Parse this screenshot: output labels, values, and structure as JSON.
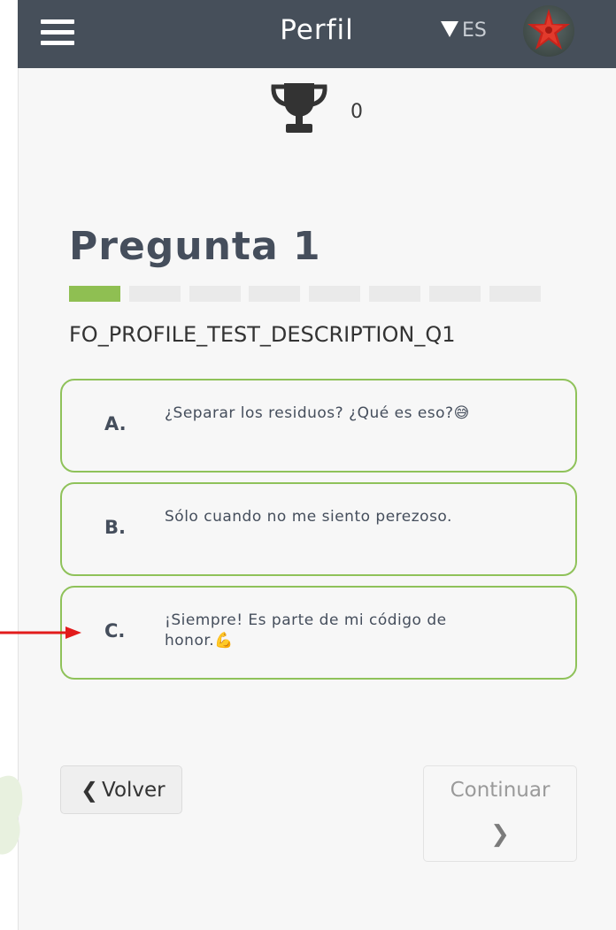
{
  "header": {
    "title": "Perfil",
    "language": "ES",
    "menu_icon": "hamburger-icon",
    "avatar_icon": "starfish-avatar"
  },
  "score": {
    "icon": "trophy-icon",
    "value": "0"
  },
  "question": {
    "title": "Pregunta 1",
    "description": "FO_PROFILE_TEST_DESCRIPTION_Q1",
    "progress": {
      "current": 1,
      "total": 8
    },
    "options": [
      {
        "letter": "A.",
        "text": "¿Separar los residuos? ¿Qué es eso?😅"
      },
      {
        "letter": "B.",
        "text": "Sólo cuando no me siento perezoso."
      },
      {
        "letter": "C.",
        "text": "¡Siempre! Es parte de mi código de honor.💪"
      }
    ]
  },
  "nav": {
    "back_label": "Volver",
    "continue_label": "Continuar"
  },
  "colors": {
    "header_bg": "#464f5a",
    "accent_green": "#8fc25a",
    "annotation_arrow": "#e21b1b"
  }
}
